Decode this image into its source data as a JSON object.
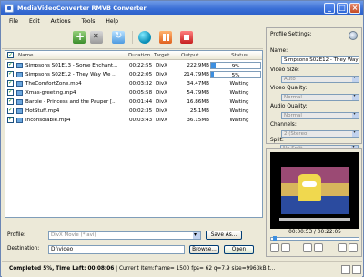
{
  "window": {
    "title": "MediaVideoConverter RMVB Converter"
  },
  "menu": [
    "File",
    "Edit",
    "Actions",
    "Tools",
    "Help"
  ],
  "table": {
    "headers": {
      "name": "Name",
      "duration": "Duration",
      "target": "Target ...",
      "output": "Output...",
      "status": "Status"
    },
    "rows": [
      {
        "name": "Simpsons S01E13 - Some Enchant...",
        "duration": "00:22:55",
        "target": "DivX",
        "output": "222.9MB",
        "status": "9%",
        "progress": 0.09
      },
      {
        "name": "Simpsons S02E12 - They Way We ...",
        "duration": "00:22:05",
        "target": "DivX",
        "output": "214.79MB",
        "status": "5%",
        "progress": 0.05
      },
      {
        "name": "TheComfortZone.mp4",
        "duration": "00:03:32",
        "target": "DivX",
        "output": "34.47MB",
        "status": "Waiting"
      },
      {
        "name": "Xmas-greeting.mp4",
        "duration": "00:05:58",
        "target": "DivX",
        "output": "54.79MB",
        "status": "Waiting"
      },
      {
        "name": "Barbie - Princess and the Pauper [...",
        "duration": "00:01:44",
        "target": "DivX",
        "output": "16.86MB",
        "status": "Waiting"
      },
      {
        "name": "HotStuff.mp4",
        "duration": "00:02:35",
        "target": "DivX",
        "output": "25.1MB",
        "status": "Waiting"
      },
      {
        "name": "Inconsolable.mp4",
        "duration": "00:03:43",
        "target": "DivX",
        "output": "36.15MB",
        "status": "Waiting"
      }
    ]
  },
  "bottom": {
    "profile_label": "Profile:",
    "profile_value": "DivX Movie (*.avi)",
    "saveas_label": "Save As...",
    "destination_label": "Destination:",
    "destination_value": "D:\\video",
    "browse_label": "Browse...",
    "open_label": "Open"
  },
  "status": {
    "completed": "Completed 5%",
    "time_left": ", Time Left: 00:08:06",
    "current_item": " | Current Item:frame= 1500 fps= 62 q=7.9 size=9963kB t..."
  },
  "profile_settings": {
    "title": "Profile Settings:",
    "name_label": "Name:",
    "name_value": "Simpsons S02E12 - They Way",
    "video_size_label": "Video Size:",
    "video_size_value": "Auto",
    "video_quality_label": "Video Quality:",
    "video_quality_value": "Normal",
    "audio_quality_label": "Audio Quality:",
    "audio_quality_value": "Normal",
    "channels_label": "Channels:",
    "channels_value": "2 (Stereo)",
    "split_label": "Split:",
    "split_value": "No Split"
  },
  "preview": {
    "time": "00:00:53 / 00:22:05"
  }
}
